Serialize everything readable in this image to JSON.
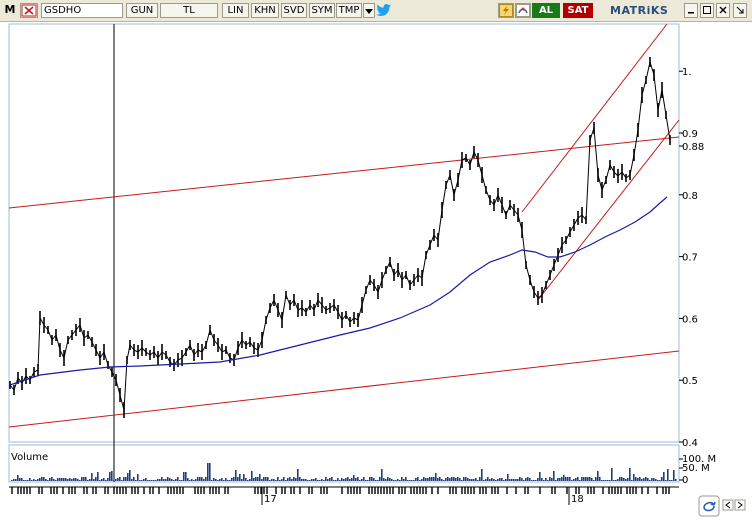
{
  "toolbar": {
    "logo_letter": "M",
    "symbol": "GSDHO",
    "buttons": [
      "GUN",
      "TL",
      "LIN",
      "KHN",
      "SVD",
      "SYM",
      "TMP"
    ],
    "buy_label": "AL",
    "sell_label": "SAT",
    "brand": "MATRiKS",
    "colors": {
      "buy": "#1a7a1a",
      "sell": "#b00000",
      "twitter": "#1da1f2"
    }
  },
  "chart_data": {
    "type": "line",
    "price_axis": {
      "ticks": [
        "1.",
        "0.9",
        "0.88",
        "0.8",
        "0.7",
        "0.6",
        "0.5",
        "0.4"
      ],
      "ylim": [
        0.4,
        1.07
      ],
      "current": "0.88"
    },
    "volume_axis": {
      "label": "Volume",
      "ticks": [
        "100. M",
        "50. M",
        "0"
      ]
    },
    "x_labels": [
      "17",
      "18"
    ],
    "series": [
      {
        "name": "price",
        "color": "#000000"
      },
      {
        "name": "ma",
        "color": "#1a1aa6"
      }
    ]
  }
}
